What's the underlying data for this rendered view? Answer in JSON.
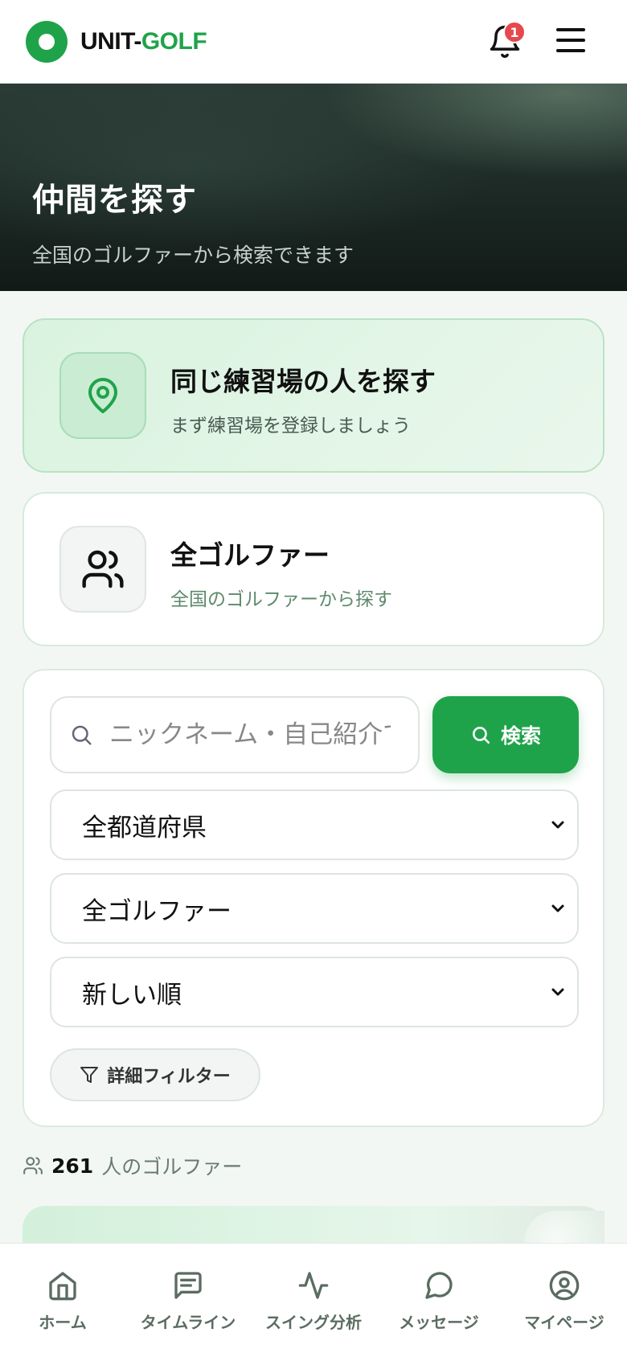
{
  "header": {
    "logo_part1": "UNIT-",
    "logo_part2": "GOLF",
    "notification_count": "1"
  },
  "hero": {
    "title": "仲間を探す",
    "subtitle": "全国のゴルファーから検索できます"
  },
  "cards": {
    "same_range": {
      "title": "同じ練習場の人を探す",
      "subtitle": "まず練習場を登録しましょう",
      "icon": "map-pin-icon"
    },
    "all_golfers": {
      "title": "全ゴルファー",
      "subtitle": "全国のゴルファーから探す",
      "icon": "users-icon"
    }
  },
  "search": {
    "placeholder": "ニックネーム・自己紹介で検索",
    "value": "",
    "button_label": "検索",
    "prefecture": "全都道府県",
    "golfer_type": "全ゴルファー",
    "sort": "新しい順",
    "filter_label": "詳細フィルター"
  },
  "results": {
    "count": "261",
    "label": "人のゴルファー"
  },
  "bottom_nav": {
    "items": [
      {
        "label": "ホーム",
        "icon": "home-icon"
      },
      {
        "label": "タイムライン",
        "icon": "timeline-icon"
      },
      {
        "label": "スイング分析",
        "icon": "activity-icon"
      },
      {
        "label": "メッセージ",
        "icon": "message-icon"
      },
      {
        "label": "マイページ",
        "icon": "user-circle-icon"
      }
    ]
  },
  "colors": {
    "accent": "#1fa34a",
    "badge": "#e5484d",
    "nav_text": "#5b6c61"
  }
}
